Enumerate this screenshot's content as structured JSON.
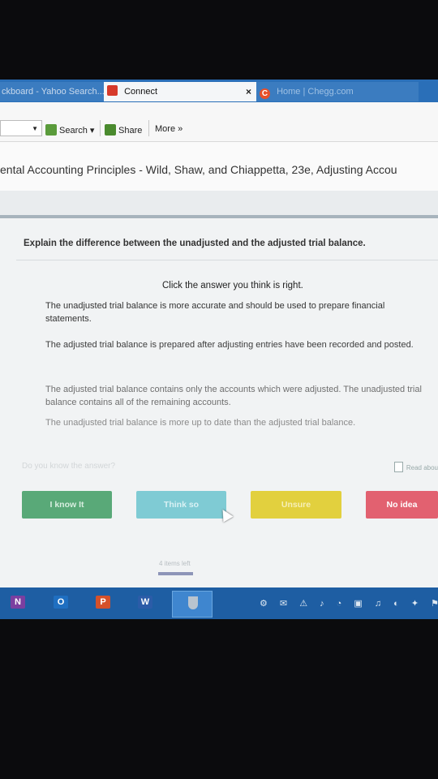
{
  "browser": {
    "tabs": [
      {
        "label": "ckboard - Yahoo Search..."
      },
      {
        "label": "Connect"
      },
      {
        "label": "Home | Chegg.com"
      }
    ],
    "tab_close": "×",
    "chegg_fav": "C"
  },
  "toolbar": {
    "search_label": "Search",
    "share_label": "Share",
    "more_label": "More »"
  },
  "course": {
    "title": "ental Accounting Principles - Wild, Shaw, and Chiappetta, 23e, Adjusting Accou"
  },
  "quiz": {
    "question": "Explain the difference between the unadjusted and the adjusted trial balance.",
    "instruction": "Click the answer you think is right.",
    "answers": [
      "The unadjusted trial balance is more accurate and should be used to prepare financial statements.",
      "The adjusted trial balance is prepared after adjusting entries have been recorded and posted.",
      "The adjusted trial balance contains only the accounts which were adjusted. The unadjusted trial balance contains all of the remaining accounts.",
      "The unadjusted trial balance is more up to date than the adjusted trial balance."
    ],
    "hint": "Do you know the answer?",
    "read_about": "Read abou",
    "buttons": {
      "know": "I know It",
      "think": "Think so",
      "unsure": "Unsure",
      "no_idea": "No idea"
    },
    "items_left": "4 items left",
    "progress": 1.0
  },
  "taskbar": {
    "apps": [
      "N",
      "O",
      "P",
      "W"
    ],
    "tray": "⚙ ✉ ⚠ ♪ ◔ ▣ ♫ ◐ ✦ ⚑"
  }
}
